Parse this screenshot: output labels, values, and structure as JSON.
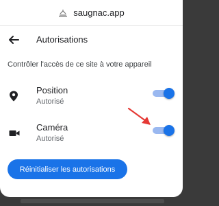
{
  "topbar": {
    "site": "saugnac.app",
    "site_icon": "site-emblem-icon"
  },
  "header": {
    "title": "Autorisations",
    "back_icon": "back-arrow-icon"
  },
  "subtitle": "Contrôler l'accès de ce site à votre appareil",
  "permissions": [
    {
      "name": "Position",
      "status": "Autorisé",
      "icon": "location-pin-icon",
      "enabled": true
    },
    {
      "name": "Caméra",
      "status": "Autorisé",
      "icon": "camera-icon",
      "enabled": true
    }
  ],
  "reset_button": "Réinitialiser les autorisations",
  "colors": {
    "accent": "#1a73e8",
    "track": "#9ab8f0",
    "annotation_arrow": "#e53935"
  }
}
